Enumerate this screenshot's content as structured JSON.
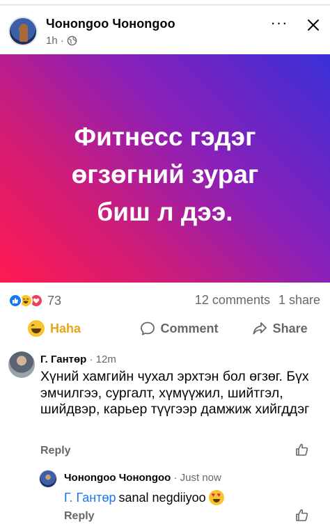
{
  "post": {
    "author": "Чонongoo Чонongoo",
    "time": "1h",
    "separator": "·",
    "image_text": "Фитнесс гэдэг өгзөгний зураг биш л дээ.",
    "image_text_lines": [
      "Фитнесс гэдэг",
      "өгзөгний зураг",
      "биш л дээ."
    ]
  },
  "stats": {
    "reaction_icons": [
      "like-icon",
      "haha-icon",
      "love-icon"
    ],
    "reaction_count": "73",
    "comments": "12 comments",
    "shares": "1 share"
  },
  "actions": {
    "haha_label": "Haha",
    "comment_label": "Comment",
    "share_label": "Share"
  },
  "comments": [
    {
      "author": "Г. Гантөр",
      "time": "· 12m",
      "text": "Хүний хамгийн чухал эрхтэн бол өгзөг. Бүх эмчилгээ, сургалт, хүмүүжил, шийтгэл, шийдвэр, карьер түүгээр дамжиж хийгддэг",
      "reply_label": "Reply"
    },
    {
      "author": "Чонongoo Чонongoo",
      "time": "· Just now",
      "mention": "Г. Гантөр",
      "text": "sanal negdiiyoo",
      "reply_label": "Reply"
    }
  ],
  "colors": {
    "brand_blue": "#1877f2",
    "haha_yellow": "#e7a517",
    "gradient": [
      "#ff1a50",
      "#d01c78",
      "#8a20b8",
      "#3a2fd8"
    ]
  }
}
